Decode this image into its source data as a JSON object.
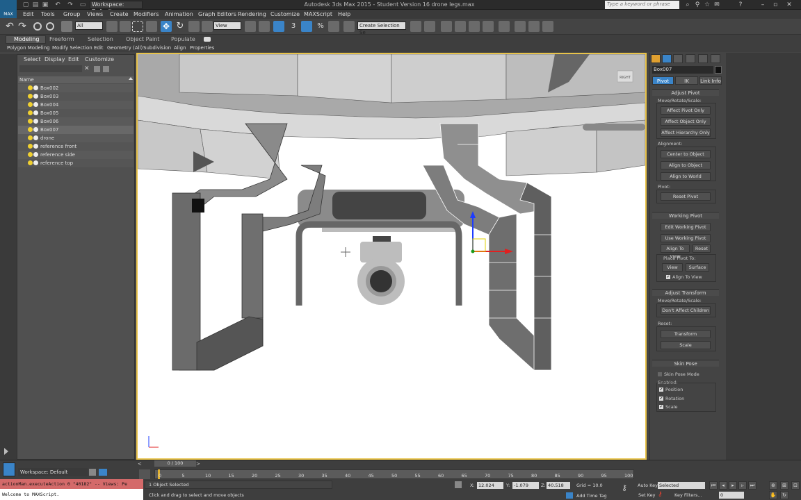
{
  "titlebar": {
    "app_logo": "MAX",
    "workspace": "Workspace: Default",
    "window_title": "Autodesk 3ds Max 2015 - Student Version   16 drone legs.max",
    "search_placeholder": "Type a keyword or phrase"
  },
  "menu": [
    "Edit",
    "Tools",
    "Group",
    "Views",
    "Create",
    "Modifiers",
    "Animation",
    "Graph Editors",
    "Rendering",
    "Customize",
    "MAXScript",
    "Help"
  ],
  "toolbar": {
    "selection_filter": "All",
    "ref_coord": "View",
    "named_sel": "Create Selection Se",
    "snap_label": "3"
  },
  "ribbon": {
    "tabs": [
      "Modeling",
      "Freeform",
      "Selection",
      "Object Paint",
      "Populate"
    ],
    "items": [
      "Polygon Modeling",
      "Modify Selection",
      "Edit",
      "Geometry (All)",
      "Subdivision",
      "Align",
      "Properties"
    ]
  },
  "explorer": {
    "tabs": [
      "Select",
      "Display",
      "Edit",
      "Customize"
    ],
    "header": "Name",
    "rows": [
      {
        "label": "Box002",
        "selected": false
      },
      {
        "label": "Box003",
        "selected": false
      },
      {
        "label": "Box004",
        "selected": false
      },
      {
        "label": "Box005",
        "selected": false
      },
      {
        "label": "Box006",
        "selected": false
      },
      {
        "label": "Box007",
        "selected": true
      },
      {
        "label": "drone",
        "selected": false
      },
      {
        "label": "reference front",
        "selected": false
      },
      {
        "label": "reference side",
        "selected": false
      },
      {
        "label": "reference top",
        "selected": false
      }
    ]
  },
  "viewport": {
    "viewcube_label": "RIGHT"
  },
  "cmdpanel": {
    "object_name": "Box007",
    "subtabs": [
      "Pivot",
      "IK",
      "Link Info"
    ],
    "adjust_pivot": {
      "title": "Adjust Pivot",
      "move_label": "Move/Rotate/Scale:",
      "affect_pivot": "Affect Pivot Only",
      "affect_object": "Affect Object Only",
      "affect_hierarchy": "Affect Hierarchy Only",
      "alignment_label": "Alignment:",
      "center_to_object": "Center to Object",
      "align_to_object": "Align to Object",
      "align_to_world": "Align to World",
      "pivot_label": "Pivot:",
      "reset_pivot": "Reset Pivot"
    },
    "working_pivot": {
      "title": "Working Pivot",
      "edit": "Edit Working Pivot",
      "use": "Use Working Pivot",
      "align_to_view": "Align To View",
      "reset": "Reset",
      "place_label": "Place Pivot To:",
      "view": "View",
      "surface": "Surface",
      "align_check": "Align To View"
    },
    "adjust_transform": {
      "title": "Adjust Transform",
      "move_label": "Move/Rotate/Scale:",
      "dont_affect": "Don't Affect Children",
      "reset_label": "Reset:",
      "transform": "Transform",
      "scale": "Scale"
    },
    "skin_pose": {
      "title": "Skin Pose",
      "mode": "Skin Pose Mode",
      "enabled_label": "Enabled:",
      "position": "Position",
      "rotation": "Rotation",
      "scale": "Scale"
    }
  },
  "bottom": {
    "workspace": "Workspace: Default",
    "time_slider": "0 / 100",
    "ticks": [
      "0",
      "5",
      "10",
      "15",
      "20",
      "25",
      "30",
      "35",
      "40",
      "45",
      "50",
      "55",
      "60",
      "65",
      "70",
      "75",
      "80",
      "85",
      "90",
      "95",
      "100"
    ],
    "script_line1": "actionMan.executeAction 0 \"40182\"  -- Views: Pe",
    "script_line2": "Welcome to MAXScript.",
    "status1": "1 Object Selected",
    "status2": "Click and drag to select and move objects",
    "x_label": "X:",
    "x_value": "12.024",
    "y_label": "Y:",
    "y_value": "-1.079",
    "z_label": "Z:",
    "z_value": "40.518",
    "grid": "Grid = 10.0",
    "add_time_tag": "Add Time Tag",
    "auto_key": "Auto Key",
    "set_key": "Set Key",
    "key_mode": "Selected",
    "key_filters": "Key Filters...",
    "frame": "0"
  },
  "colors": {
    "viewport_border": "#e8c34a",
    "active_tab": "#3a84c8",
    "script_error": "#d46a6a"
  }
}
